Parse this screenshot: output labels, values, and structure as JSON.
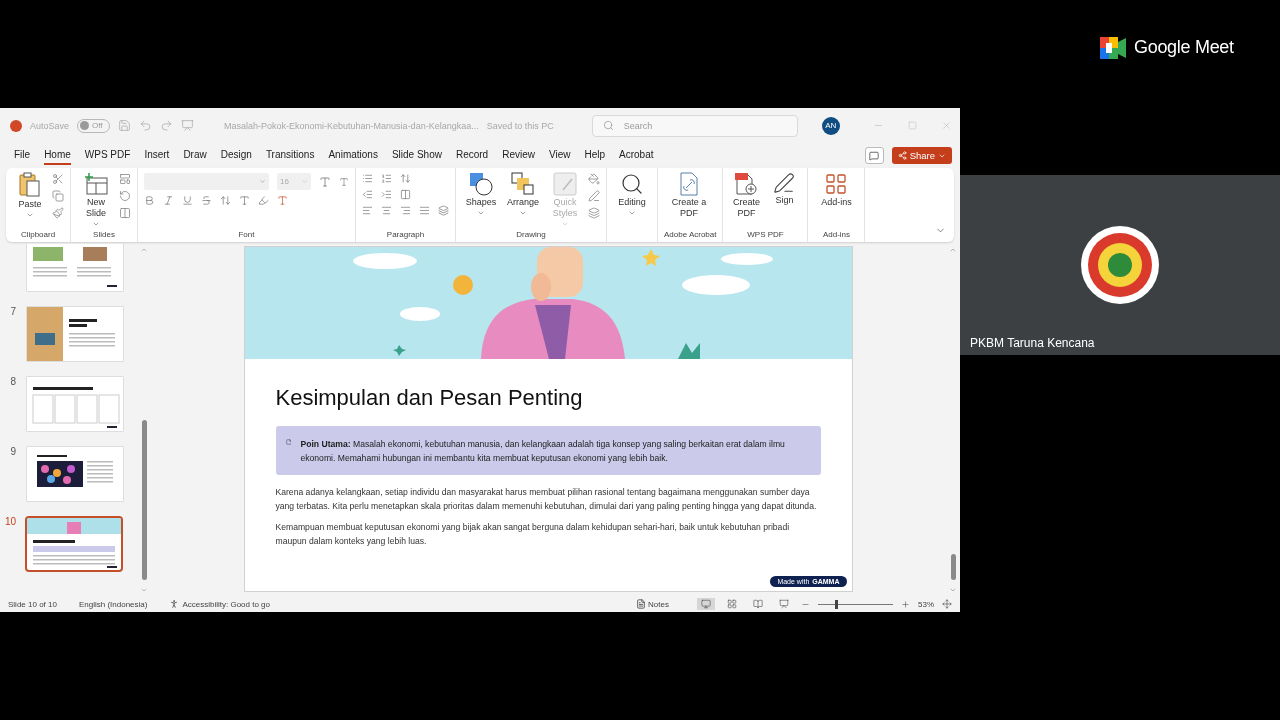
{
  "meet": {
    "brand": "Google Meet",
    "participant": {
      "name": "PKBM Taruna Kencana"
    }
  },
  "title_bar": {
    "autosave_label": "AutoSave",
    "autosave": {
      "on": false,
      "state": "Off"
    },
    "document_title": "Masalah-Pokok-Ekonomi-Kebutuhan-Manusia-dan-Kelangkaa...",
    "save_status": "Saved to this PC",
    "search_placeholder": "Search",
    "user_initials": "AN"
  },
  "menu_tabs": [
    {
      "label": "File",
      "selected": false
    },
    {
      "label": "Home",
      "selected": true
    },
    {
      "label": "WPS PDF",
      "selected": false
    },
    {
      "label": "Insert",
      "selected": false
    },
    {
      "label": "Draw",
      "selected": false
    },
    {
      "label": "Design",
      "selected": false
    },
    {
      "label": "Transitions",
      "selected": false
    },
    {
      "label": "Animations",
      "selected": false
    },
    {
      "label": "Slide Show",
      "selected": false
    },
    {
      "label": "Record",
      "selected": false
    },
    {
      "label": "Review",
      "selected": false
    },
    {
      "label": "View",
      "selected": false
    },
    {
      "label": "Help",
      "selected": false
    },
    {
      "label": "Acrobat",
      "selected": false
    }
  ],
  "share_label": "Share",
  "ribbon": [
    {
      "kind": "clipboard",
      "label": "Clipboard",
      "buttons": [
        {
          "kind": "paste",
          "label": "Paste",
          "has_menu": true,
          "disabled": false
        }
      ]
    },
    {
      "kind": "slides",
      "label": "Slides",
      "buttons": [
        {
          "kind": "new-slide",
          "label": "New Slide",
          "has_menu": true,
          "disabled": false
        }
      ]
    },
    {
      "kind": "font",
      "label": "Font",
      "font_size": "16"
    },
    {
      "kind": "paragraph",
      "label": "Paragraph"
    },
    {
      "kind": "drawing",
      "label": "Drawing",
      "buttons": [
        {
          "kind": "shapes",
          "label": "Shapes",
          "has_menu": true,
          "disabled": false
        },
        {
          "kind": "arrange",
          "label": "Arrange",
          "has_menu": true,
          "disabled": false
        },
        {
          "kind": "quick-styles",
          "label": "Quick Styles",
          "has_menu": true,
          "disabled": true
        }
      ]
    },
    {
      "kind": "editing",
      "buttons": [
        {
          "kind": "editing",
          "label": "Editing",
          "has_menu": true,
          "disabled": false
        }
      ]
    },
    {
      "kind": "acrobat",
      "label": "Adobe Acrobat",
      "buttons": [
        {
          "kind": "create-pdf",
          "label": "Create a PDF",
          "has_menu": false,
          "disabled": false
        }
      ]
    },
    {
      "kind": "wps",
      "label": "WPS PDF",
      "buttons": [
        {
          "kind": "pdf-plus",
          "label": "Create PDF",
          "has_menu": false,
          "disabled": false
        },
        {
          "kind": "sign",
          "label": "Sign",
          "has_menu": false,
          "disabled": false
        }
      ]
    },
    {
      "kind": "addins",
      "label": "Add-ins",
      "buttons": [
        {
          "kind": "addins",
          "label": "Add-ins",
          "has_menu": false,
          "disabled": false
        }
      ]
    }
  ],
  "thumbnails": [
    {
      "kind": "two-images",
      "selected": false
    },
    {
      "kind": "photo-left",
      "number": "7",
      "selected": false
    },
    {
      "kind": "table",
      "number": "8",
      "selected": false
    },
    {
      "kind": "gears",
      "number": "9",
      "selected": false
    },
    {
      "kind": "banner",
      "number": "10",
      "selected": true
    }
  ],
  "slide": {
    "title": "Kesimpulan dan Pesan Penting",
    "callout": "**Poin Utama:** Masalah ekonomi, kebutuhan manusia, dan kelangkaan adalah tiga konsep yang saling berkaitan erat dalam ilmu ekonomi. Memahami hubungan ini membantu kita membuat keputusan ekonomi yang lebih baik.",
    "paragraphs": [
      "Karena adanya kelangkaan, setiap individu dan masyarakat harus membuat pilihan rasional tentang bagaimana menggunakan sumber daya yang terbatas. Kita perlu menetapkan skala prioritas dalam memenuhi kebutuhan, dimulai dari yang paling penting hingga yang dapat ditunda.",
      "Kemampuan membuat keputusan ekonomi yang bijak akan sangat berguna dalam kehidupan sehari-hari, baik untuk kebutuhan pribadi maupun dalam konteks yang lebih luas."
    ],
    "badge": {
      "prefix": "Made with",
      "brand": "GAMMA"
    }
  },
  "status_bar": {
    "slide_info": "Slide 10 of 10",
    "language": "English (Indonesia)",
    "accessibility": "Accessibility: Good to go",
    "notes": "Notes",
    "views": [
      {
        "kind": "normal",
        "selected": true
      },
      {
        "kind": "sorter",
        "selected": false
      },
      {
        "kind": "reading",
        "selected": false
      },
      {
        "kind": "show",
        "selected": false
      }
    ],
    "zoom": {
      "level": 0.24,
      "reading": "53%"
    }
  }
}
